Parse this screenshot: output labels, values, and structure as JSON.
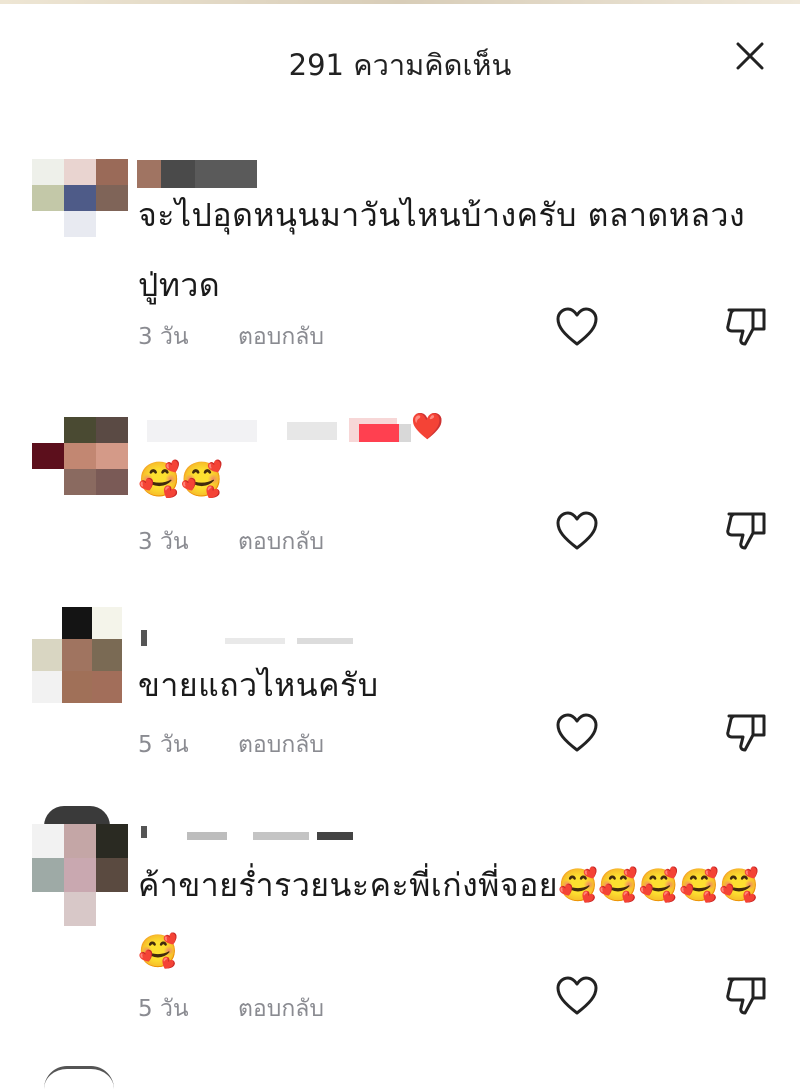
{
  "header": {
    "title": "291 ความคิดเห็น"
  },
  "icons": {
    "close": "close-icon",
    "like": "heart-outline-icon",
    "dislike": "thumbs-down-icon"
  },
  "colors": {
    "text": "#1a1a1a",
    "meta": "#8a8b91",
    "heart": "#ff3b4e"
  },
  "comments": [
    {
      "text": "จะไปอุดหนุนมาวันไหนบ้างครับ ตลาดหลวงปู่ทวด",
      "time": "3 วัน",
      "reply": "ตอบกลับ"
    },
    {
      "text": "🥰🥰",
      "name_suffix": "❤️",
      "time": "3 วัน",
      "reply": "ตอบกลับ"
    },
    {
      "text": "ขายแถวไหนครับ",
      "time": "5 วัน",
      "reply": "ตอบกลับ"
    },
    {
      "text": "ค้าขายร่ำรวยนะคะพี่เก่งพี่จอย🥰🥰🥰🥰🥰🥰",
      "time": "5 วัน",
      "reply": "ตอบกลับ"
    }
  ]
}
